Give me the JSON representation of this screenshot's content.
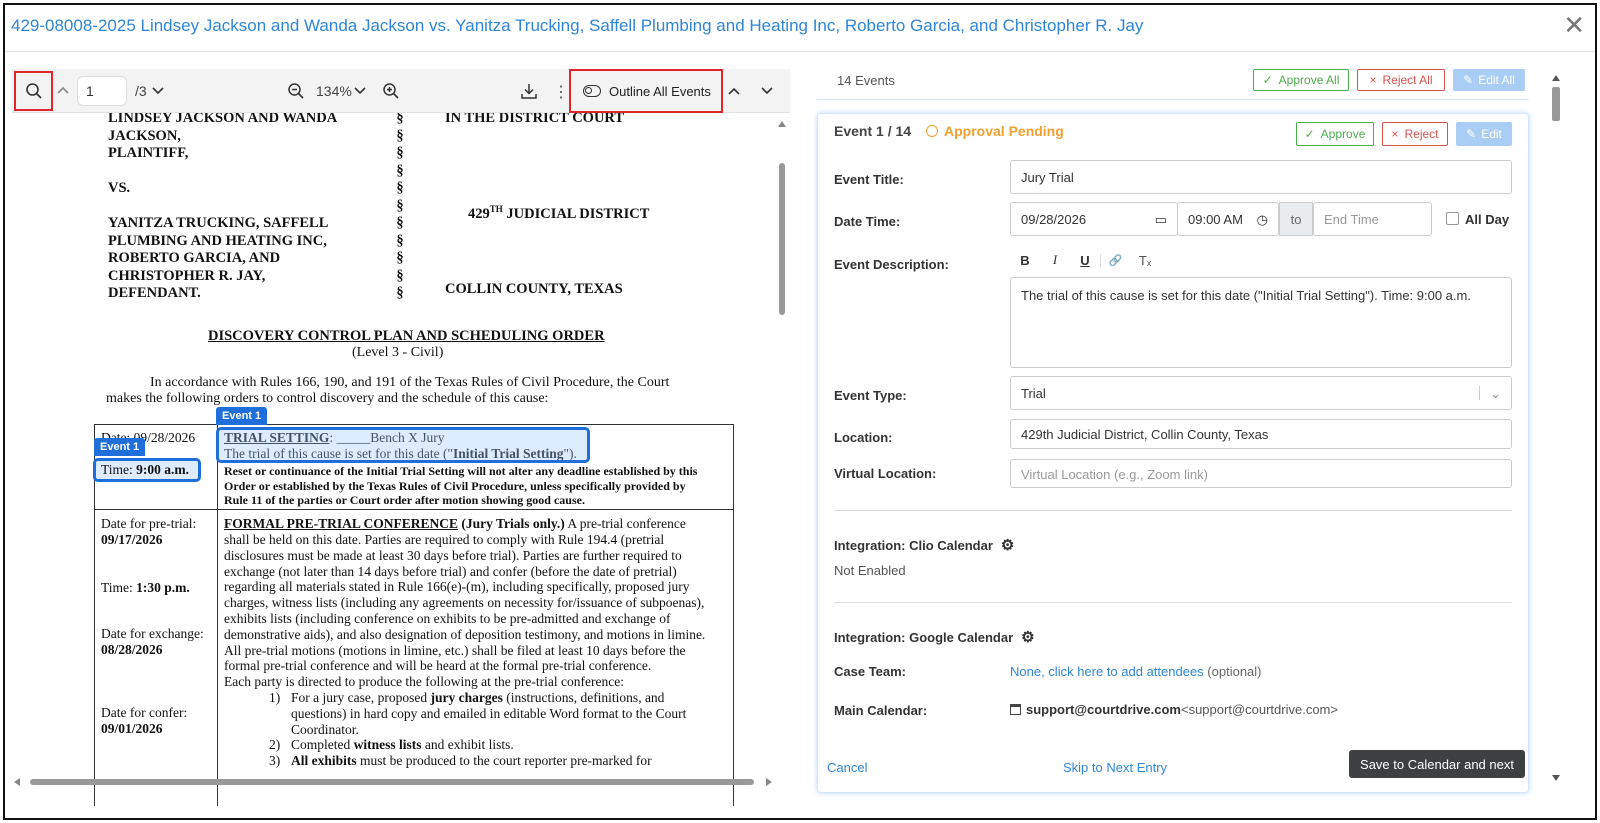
{
  "header": {
    "title": "429-08008-2025 Lindsey Jackson and Wanda Jackson vs. Yanitza Trucking, Saffell Plumbing and Heating Inc, Roberto Garcia, and Christopher R. Jay",
    "close_icon": "close-icon"
  },
  "viewer": {
    "page_value": "1",
    "page_total": "/3",
    "zoom": "134%",
    "outline_label": "Outline All Events",
    "icons": [
      "search-icon",
      "chevron-up-icon",
      "chevron-down-icon",
      "zoom-out-icon",
      "zoom-in-icon",
      "download-icon",
      "more-vertical-icon",
      "toggle-icon"
    ]
  },
  "document": {
    "caption_left": [
      "LINDSEY JACKSON AND WANDA",
      "JACKSON,",
      "PLAINTIFF,",
      "",
      "VS.",
      "",
      "YANITZA TRUCKING, SAFFELL",
      "PLUMBING AND HEATING INC,",
      "ROBERTO GARCIA, AND",
      "CHRISTOPHER R. JAY,",
      "DEFENDANT."
    ],
    "caption_right_1": "IN THE DISTRICT COURT",
    "caption_right_2a": "429",
    "caption_right_2sup": "TH",
    "caption_right_2b": " JUDICIAL DISTRICT",
    "caption_right_3": "COLLIN COUNTY, TEXAS",
    "section": "§",
    "title": "DISCOVERY CONTROL PLAN AND SCHEDULING ORDER",
    "subtitle": "(Level 3 - Civil)",
    "intro_1": "In accordance with Rules 166, 190, and 191 of the Texas Rules of Civil Procedure, the Court",
    "intro_2": "makes the following orders to control discovery and the schedule of this cause:",
    "event_tag": "Event 1",
    "row1_date": "Date: 09/28/2026",
    "row1_time_lbl": "Time: ",
    "row1_time": "9:00 a.m.",
    "trial_heading": "TRIAL SETTING",
    "trial_rest": ": _____Bench   X  Jury",
    "trial_line2a": "The trial of this cause is set for this date (\"",
    "trial_line2b": "Initial Trial Setting",
    "trial_line2c": "\").",
    "reset": [
      "Reset or continuance of the Initial Trial Setting will not alter any deadline established by this",
      "Order or established by the Texas Rules of Civil Procedure, unless specifically provided by",
      "Rule 11 of the parties or Court order after motion showing good cause."
    ],
    "left_col": [
      {
        "lbl": "Date for pre-trial:",
        "val": "09/17/2026"
      },
      {
        "lbl": "Time: ",
        "val": "1:30 p.m."
      },
      {
        "lbl": "Date for exchange:",
        "val": "08/28/2026"
      },
      {
        "lbl": "Date for confer:",
        "val": "09/01/2026"
      }
    ],
    "pretrial_heading": "FORMAL PRE-TRIAL CONFERENCE",
    "pretrial_jury": " (Jury Trials only.)",
    "pretrial_rest": " A pre-trial conference",
    "pretrial_lines": [
      "shall be held on this date.  Parties are required to comply with Rule 194.4 (pretrial",
      "disclosures must be made at least 30 days before trial).  Parties are further required to",
      "exchange (not later than 14 days before trial) and confer (before the date of pretrial)",
      "regarding all materials stated in Rule 166(e)-(m), including specifically, proposed jury",
      "charges, witness lists (including any agreements on necessity for/issuance of subpoenas),",
      "exhibits lists (including conference on exhibits to be pre-admitted and exchange of",
      "demonstrative aids), and also designation of deposition testimony, and motions in limine.",
      "All pre-trial motions (motions in limine, etc.) shall be filed at least 10 days before the",
      "formal pre-trial conference and will be heard at the formal pre-trial conference.",
      "Each party is directed to produce the following at the pre-trial conference:"
    ],
    "list": [
      {
        "n": "1)",
        "a": "For a jury case, proposed ",
        "b": "jury charges",
        "c": " (instructions, definitions, and"
      },
      {
        "n": "",
        "a": "questions) in hard copy and emailed in editable Word format to the Court",
        "b": "",
        "c": ""
      },
      {
        "n": "",
        "a": "Coordinator.",
        "b": "",
        "c": ""
      },
      {
        "n": "2)",
        "a": "Completed ",
        "b": "witness lists",
        "c": " and exhibit lists."
      },
      {
        "n": "3)",
        "a": "",
        "b": "All exhibits",
        "c": " must be produced to the court reporter pre-marked for"
      }
    ]
  },
  "panel": {
    "events_count": "14 Events",
    "approve_all": "Approve All",
    "reject_all": "Reject All",
    "edit_all": "Edit All",
    "event_num": "Event 1 / 14",
    "status": "Approval Pending",
    "approve": "Approve",
    "reject": "Reject",
    "edit": "Edit",
    "title_lbl": "Event Title:",
    "title_val": "Jury Trial",
    "dt_lbl": "Date Time:",
    "date_val": "09/28/2026",
    "time_val": "09:00 AM",
    "to": "to",
    "end_ph": "End Time",
    "allday": "All Day",
    "desc_lbl": "Event Description:",
    "desc_val": "The trial of this cause is set for this date (\"Initial Trial Setting\"). Time: 9:00 a.m.",
    "fmt": [
      "B",
      "I",
      "U",
      "🔗",
      "Tₓ"
    ],
    "type_lbl": "Event Type:",
    "type_val": "Trial",
    "loc_lbl": "Location:",
    "loc_val": "429th Judicial District, Collin County, Texas",
    "vloc_lbl": "Virtual Location:",
    "vloc_ph": "Virtual Location (e.g., Zoom link)",
    "clio_lbl": "Integration: Clio Calendar",
    "clio_val": "Not Enabled",
    "google_lbl": "Integration: Google Calendar",
    "team_lbl": "Case Team:",
    "team_link": "None, click here to add attendees",
    "team_opt": " (optional)",
    "cal_lbl": "Main Calendar:",
    "cal_email": "support@courtdrive.com",
    "cal_email2": " <support@courtdrive.com>",
    "cancel": "Cancel",
    "skip": "Skip to Next Entry",
    "save": "Save to Calendar and next"
  },
  "colors": {
    "accent": "#2f86d8",
    "event_blue": "#1e6fd9",
    "pending": "#f0a030",
    "green": "#4cae4c",
    "red": "#d9534f",
    "dark_btn": "#3d3f41"
  }
}
